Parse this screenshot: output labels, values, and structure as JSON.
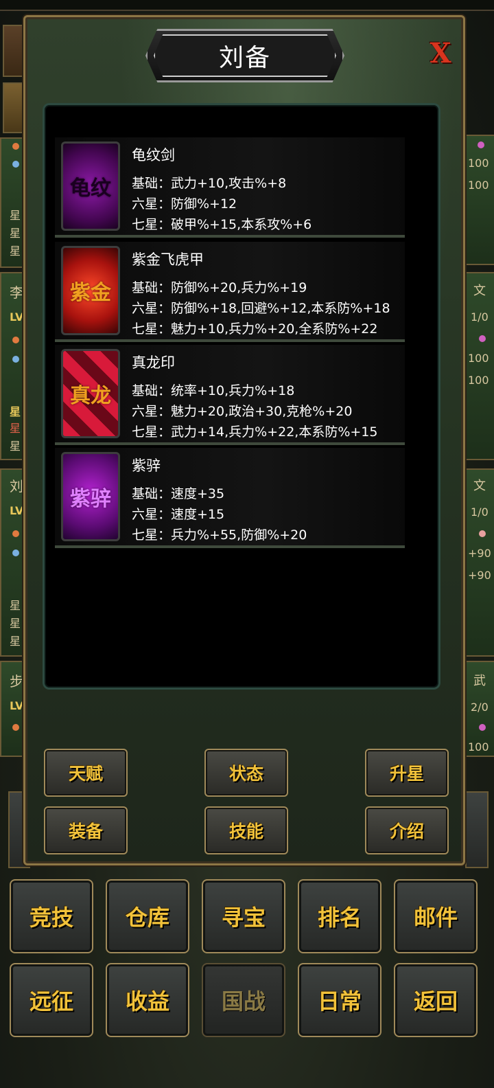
{
  "dialog": {
    "title": "刘备",
    "close_label": "X",
    "equipment": [
      {
        "name": "龟纹剑",
        "icon_text": "龟纹",
        "icon": "sword-icon",
        "lines": [
          "基础：武力+10,攻击%+8",
          "六星：防御%+12",
          "七星：破甲%+15,本系攻%+6"
        ]
      },
      {
        "name": "紫金飞虎甲",
        "icon_text": "紫金",
        "icon": "armor-icon",
        "lines": [
          "基础：防御%+20,兵力%+19",
          "六星：防御%+18,回避%+12,本系防%+18",
          "七星：魅力+10,兵力%+20,全系防%+22"
        ]
      },
      {
        "name": "真龙印",
        "icon_text": "真龙",
        "icon": "seal-icon",
        "lines": [
          "基础：统率+10,兵力%+18",
          "六星：魅力+20,政治+30,克枪%+20",
          "七星：武力+14,兵力%+22,本系防%+15"
        ]
      },
      {
        "name": "紫骍",
        "icon_text": "紫骍",
        "icon": "horse-icon",
        "lines": [
          "基础：速度+35",
          "六星：速度+15",
          "七星：兵力%+55,防御%+20"
        ]
      }
    ],
    "buttons": [
      "天赋",
      "状态",
      "升星",
      "装备",
      "技能",
      "介绍"
    ]
  },
  "bottom_nav": {
    "row1": [
      "竞技",
      "仓库",
      "寻宝",
      "排名",
      "邮件"
    ],
    "row2": [
      "远征",
      "收益",
      "国战",
      "日常",
      "返回"
    ]
  },
  "background": {
    "left_texts": [
      "星",
      "星",
      "星",
      "李",
      "LV",
      "星",
      "星",
      "星",
      "刘",
      "LV",
      "星",
      "星",
      "星",
      "步",
      "LV"
    ],
    "right_texts": [
      "100",
      "100",
      "文",
      "1/0",
      "100",
      "100",
      "文",
      "1/0",
      "+90",
      "+90",
      "武",
      "2/0",
      "100"
    ]
  },
  "colors": {
    "accent_gold": "#f2c23a",
    "close_red": "#d8341e",
    "panel_border": "#8d7645"
  }
}
